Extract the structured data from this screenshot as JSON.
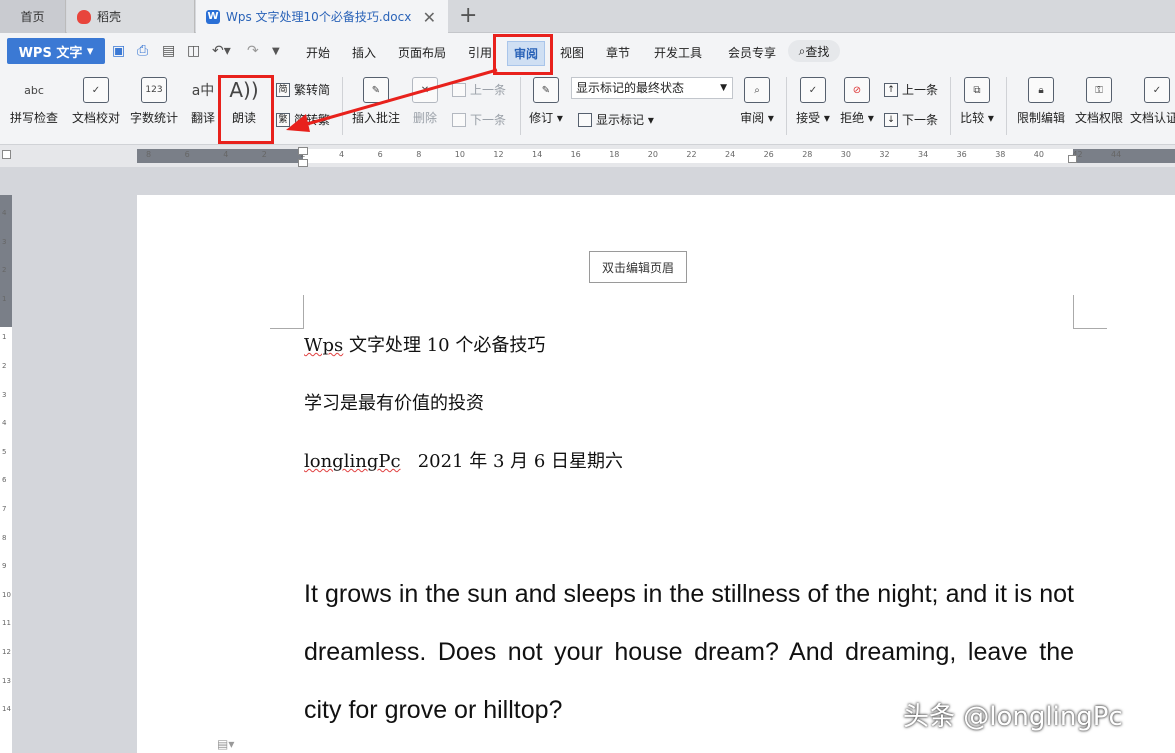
{
  "tabs": [
    {
      "label": "首页"
    },
    {
      "label": "稻壳"
    },
    {
      "label": "Wps 文字处理10个必备技巧.docx"
    }
  ],
  "tab_add": "+",
  "tab_close": "✕",
  "app_menu": "WPS 文字",
  "menus": [
    "开始",
    "插入",
    "页面布局",
    "引用",
    "审阅",
    "视图",
    "章节",
    "开发工具",
    "会员专享"
  ],
  "search_label": "查找",
  "ribbon": {
    "spell": "拼写检查",
    "proof": "文档校对",
    "wordcount": "字数统计",
    "translate": "翻译",
    "read_aloud": "朗读",
    "trad_to_simp": "繁转简",
    "simp_to_trad": "简转繁",
    "insert_comment": "插入批注",
    "delete": "删除",
    "prev": "上一条",
    "next": "下一条",
    "revise": "修订",
    "markup_state": "显示标记的最终状态",
    "show_markup": "显示标记",
    "review": "审阅",
    "accept": "接受",
    "reject": "拒绝",
    "prev2": "上一条",
    "next2": "下一条",
    "compare": "比较",
    "restrict": "限制编辑",
    "permission": "文档权限",
    "certify": "文档认证"
  },
  "ruler_ticks_h": [
    "8",
    "6",
    "4",
    "2",
    "2",
    "4",
    "6",
    "8",
    "10",
    "12",
    "14",
    "16",
    "18",
    "20",
    "22",
    "24",
    "26",
    "28",
    "30",
    "32",
    "34",
    "36",
    "38",
    "40",
    "42",
    "44"
  ],
  "ruler_ticks_v": [
    "4",
    "3",
    "2",
    "1",
    "1",
    "2",
    "3",
    "4",
    "5",
    "6",
    "7",
    "8",
    "9",
    "10",
    "11",
    "12",
    "13",
    "14"
  ],
  "document": {
    "header_hint": "双击编辑页眉",
    "line1_a": "Wps",
    "line1_b": " 文字处理 10 个必备技巧",
    "line2": "学习是最有价值的投资",
    "line3_a": "longlingPc",
    "line3_b": "   2021 年 3 月 6 日星期六",
    "paragraph": "It grows in the sun and sleeps in the stillness of the night; and it is not dreamless. Does not your house dream? And dreaming, leave the city for grove or hilltop?"
  },
  "watermark": "头条 @longlingPc",
  "colors": {
    "accent": "#3b79d4",
    "annotation": "#e8211c",
    "tab_active": "#2a63b8"
  }
}
